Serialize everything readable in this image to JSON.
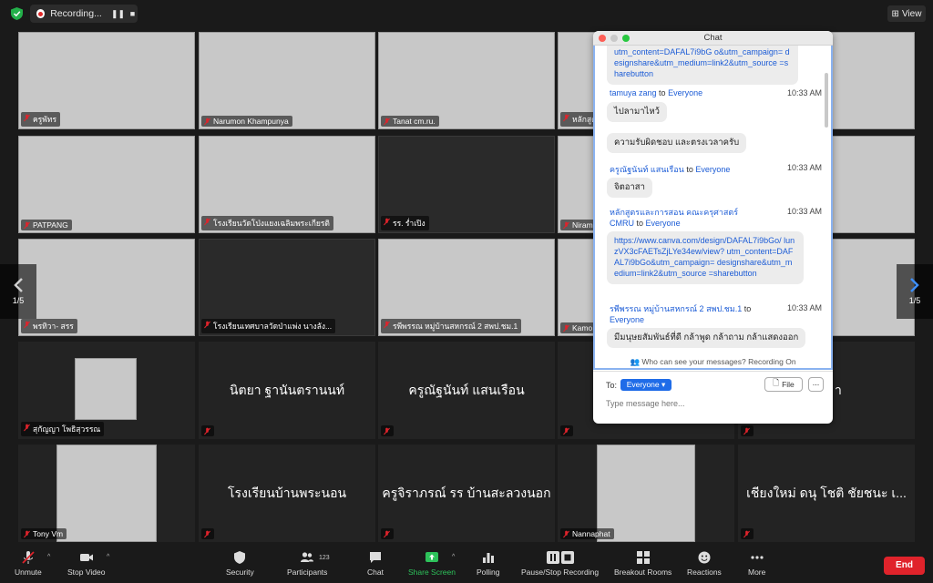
{
  "recording": {
    "label": "Recording...",
    "pause": "❚❚",
    "stop": "■"
  },
  "view_button": {
    "label": "View"
  },
  "tiles": {
    "r1c1": "ครูพัทร",
    "r1c2": "Narumon Khampunya",
    "r1c3": "Tanat cm.ru.",
    "r1c4": "หลักสูตรแ",
    "r2c1": "PATPANG",
    "r2c2": "โรงเรียนวัดโป่งแยงเฉลิมพระเกียรติ",
    "r2c3": "รร. ร่ำเปิง",
    "r2c4": "Niram",
    "r3c1": "พรทิวา- สรร",
    "r3c2": "โรงเรียนเทศบาลวัดป่าแพ่ง นางลัง...",
    "r3c3": "รพีพรรณ หมู่บ้านสหกรณ์ 2 สพป.ชม.1",
    "r3c4": "Kamo",
    "r4c1": "สุกัญญา โพธิสุวรรณ",
    "r4c2": "นิตยา ฐานันตรานนท์",
    "r4c3": "ครูณัฐนันท์ แสนเรือน",
    "r4c5_partial": "า",
    "r5c1": "Tony Vm",
    "r5c2": "โรงเรียนบ้านพระนอน",
    "r5c3": "ครูจิราภรณ์ รร บ้านสะลวงนอก",
    "r5c4": "Nannaphat",
    "r5c5": "เชียงใหม่ ดนุ โชติ ชัยชนะ เ..."
  },
  "pager": {
    "left": "1/5",
    "right": "1/5"
  },
  "chat": {
    "title": "Chat",
    "link_tail": "utm_content=DAFAL7i9bG o&utm_campaign= designshare&utm_medium=link2&utm_source =sharebutton",
    "m1": {
      "sender": "tamuya zang",
      "to": "to",
      "recipient": "Everyone",
      "time": "10:33 AM",
      "bubble1": "ไปลามาไหว้",
      "bubble2": "ความรับผิดชอบ และตรงเวลาครับ"
    },
    "m2": {
      "sender": "ครูณัฐนันท์ แสนเรือน",
      "to": "to",
      "recipient": "Everyone",
      "time": "10:33 AM",
      "bubble": "จิตอาสา"
    },
    "m3": {
      "sender": "หลักสูตรและการสอน คณะครุศาสตร์ CMRU",
      "to": "to",
      "recipient": "Everyone",
      "time": "10:33 AM",
      "link": "https://www.canva.com/design/DAFAL7i9bGo/ lunzVX3cFAETsZjLYe34ew/view? utm_content=DAFAL7i9bGo&utm_campaign= designshare&utm_medium=link2&utm_source =sharebutton"
    },
    "m4": {
      "sender": "รพีพรรณ หมู่บ้านสหกรณ์ 2 สพป.ชม.1",
      "to": "to",
      "recipient": "Everyone",
      "time": "10:33 AM",
      "bubble": "มีมนุษยสัมพันธ์ที่ดี กล้าพูด กล้าถาม กล้าแสดงออก"
    },
    "visibility_note": "Who can see your messages? Recording On",
    "to_label": "To:",
    "everyone_btn": "Everyone ▾",
    "file_btn": "File",
    "more_btn": "...",
    "input_placeholder": "Type message here..."
  },
  "toolbar": {
    "unmute": "Unmute",
    "stop_video": "Stop Video",
    "security": "Security",
    "participants": "Participants",
    "participants_count": "123",
    "chat": "Chat",
    "share_screen": "Share Screen",
    "polling": "Polling",
    "pause_stop_recording": "Pause/Stop Recording",
    "breakout_rooms": "Breakout Rooms",
    "reactions": "Reactions",
    "more": "More",
    "end": "End"
  },
  "colors": {
    "background": "#1a1a1a",
    "share_green": "#2dc25a",
    "end_red": "#e0232b",
    "link_blue": "#1c5cd6",
    "everyone_blue": "#1f6ce8"
  }
}
